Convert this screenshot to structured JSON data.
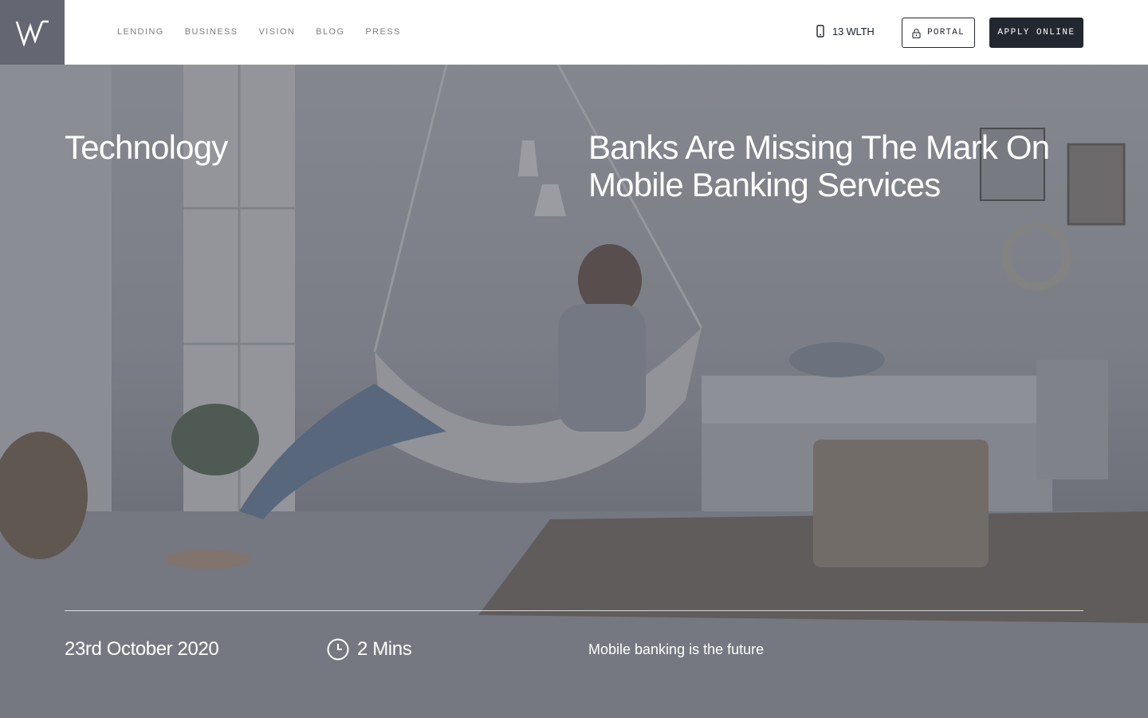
{
  "brand": {
    "logo_letter": "W",
    "logo_bg": "#646771"
  },
  "nav": {
    "items": [
      {
        "label": "LENDING"
      },
      {
        "label": "BUSINESS"
      },
      {
        "label": "VISION"
      },
      {
        "label": "BLOG"
      },
      {
        "label": "PRESS"
      }
    ]
  },
  "header": {
    "phone_icon": "mobile-phone-icon",
    "phone_label": "13 WLTH",
    "portal_icon": "lock-icon",
    "portal_label": "PORTAL",
    "apply_label": "APPLY ONLINE",
    "accent_dark": "#23272f"
  },
  "article": {
    "category": "Technology",
    "title": "Banks Are Missing The Mark On Mobile Banking Services",
    "date": "23rd October 2020",
    "read_time_icon": "clock-icon",
    "read_time": "2 Mins",
    "summary": "Mobile banking is the future"
  }
}
